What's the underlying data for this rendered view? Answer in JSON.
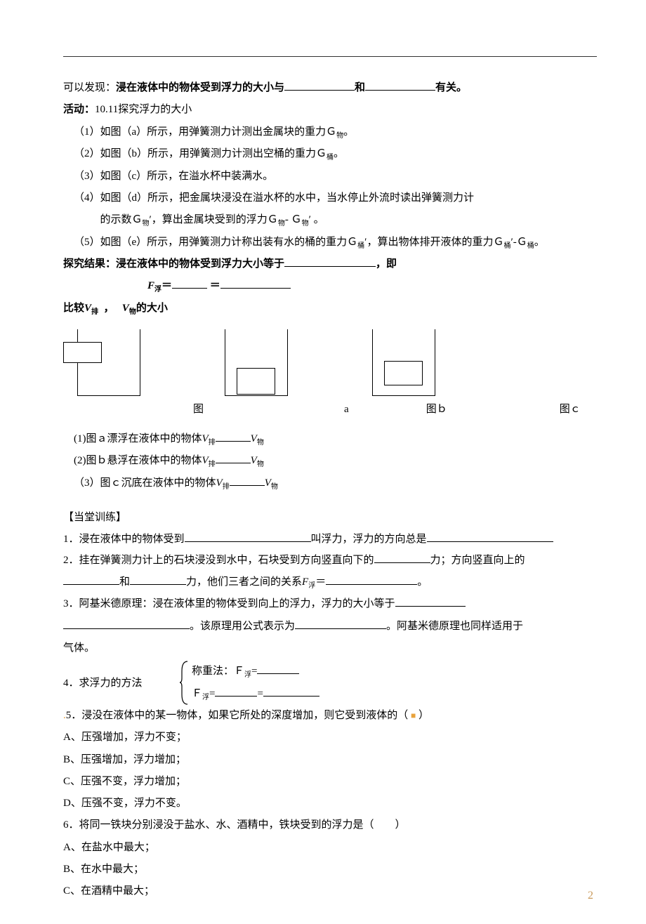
{
  "hr_line": "—",
  "discovery": {
    "prefix": "可以发现：",
    "bold_part": "浸在液体中的物体受到浮力的大小与",
    "mid": "和",
    "suffix": "有关。"
  },
  "activity": {
    "title_bold": "活动：",
    "title_rest": "10.11探究浮力的大小",
    "step1": "（1）如图（a）所示，用弹簧测力计测出金属块的重力Ｇ",
    "step1_sub": "物",
    "step1_end": "。",
    "step2": "（2）如图（b）所示，用弹簧测力计测出空桶的重力Ｇ",
    "step2_sub": "桶",
    "step2_end": "。",
    "step3": "（3）如图（c）所示，在溢水杯中装满水。",
    "step4a": "（4）如图（d）所示，把金属块浸没在溢水杯的水中，当水停止外流时读出弹簧测力计",
    "step4b_pre": "的示数Ｇ",
    "step4b_sub1": "物",
    "step4b_mid1": "′，算出金属块受到的浮力Ｇ",
    "step4b_sub2": "物",
    "step4b_mid2": "- Ｇ",
    "step4b_sub3": "物",
    "step4b_end": "′ 。",
    "step5_pre": "（5）如图（e）所示，用弹簧测力计称出装有水的桶的重力Ｇ",
    "step5_sub1": "桶",
    "step5_mid1": "′，算出物体排开液体的重力Ｇ",
    "step5_sub2": "桶",
    "step5_mid2": "′-Ｇ",
    "step5_sub3": "桶",
    "step5_end": "。"
  },
  "result": {
    "bold_pre": "探究结果：浸在液体中的物体受到浮力大小等于",
    "bold_suf": "，即",
    "formula_F": "F",
    "formula_sub": "浮",
    "formula_eq": "＝",
    "formula_eq2": "＝"
  },
  "compare": {
    "pre": "比较",
    "V": "V",
    "sub1": "排",
    "comma": "，",
    "sub2": "物",
    "suf": "的大小"
  },
  "caption": {
    "fig": "图",
    "a": "a",
    "b": "图ｂ",
    "c": "图ｃ"
  },
  "items": {
    "i1_pre": "(1)图ａ漂浮在液体中的物体",
    "i2_pre": "(2)图ｂ悬浮在液体中的物体",
    "i3_pre": "（3）图ｃ沉底在液体中的物体",
    "V": "V",
    "sub_pai": "排",
    "sub_wu": "物"
  },
  "training": {
    "header": "【当堂训练】",
    "q1_a": "1．浸在液体中的物体受到",
    "q1_b": "叫浮力，浮力的方向总是",
    "q2_a": "2．挂在弹簧测力计上的石块浸没到水中，石块受到方向竖直向下的",
    "q2_b": "力；方向竖直向上的",
    "q2_c": "和",
    "q2_d": "力，他们三者之间的关系",
    "q2_F": "F",
    "q2_sub": "浮",
    "q2_e": "＝",
    "q2_f": "。",
    "q3_a": "3．阿基米德原理：浸在液体里的物体受到向上的浮力，浮力的大小等于",
    "q3_b": "。该原理用公式表示为",
    "q3_c": "。阿基米德原理也同样适用于",
    "q3_d": "气体。",
    "q4_a": "4．求浮力的方法",
    "q4_b1": "称重法：Ｆ",
    "q4_b1s": "浮",
    "q4_b1e": "=",
    "q4_b2": "Ｆ",
    "q4_b2s": "浮",
    "q4_b2e": "=",
    "q4_b2e2": "=",
    "q5_pre": ".",
    "q5_a": "5．浸没在液体中的某一物体，如果它所处的深度增加，则它受到液体的（",
    "q5_b": "）",
    "q5A": "A、压强增加，浮力不变；",
    "q5B": "B、压强增加，浮力增加；",
    "q5C": "C、压强不变，浮力增加；",
    "q5D": "D、压强不变，浮力不变。",
    "q6_a": "6．将同一铁块分别浸没于盐水、水、酒精中，铁块受到的浮力是（　　）",
    "q6A": "A、在盐水中最大；",
    "q6B": "B、在水中最大；",
    "q6C": "C、在酒精中最大；"
  },
  "page_number": "2"
}
